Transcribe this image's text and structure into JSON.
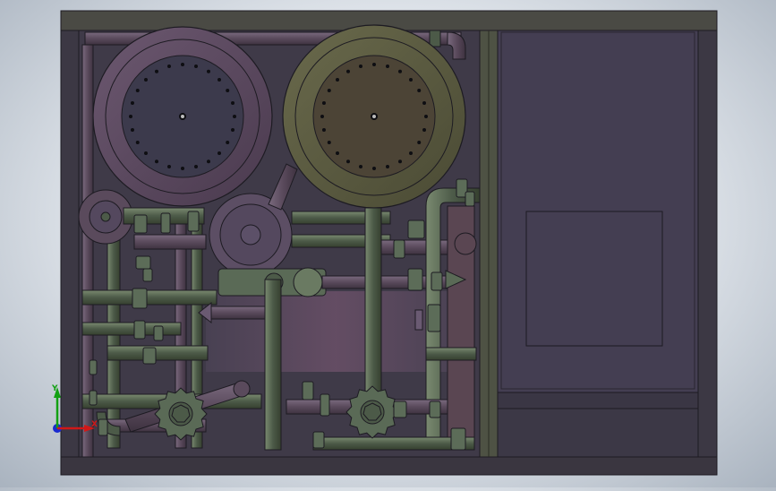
{
  "viewport": {
    "background_top": "#ffffff",
    "background_bottom": "#a9b3bf"
  },
  "colors": {
    "frame": "#3e3a46",
    "frame_edge": "#1d1b22",
    "panel": "#443e52",
    "pipe_green": "#4c5a48",
    "pipe_green_light": "#6a7a62",
    "pipe_purple": "#5a4a5c",
    "tank_left": "#5c4a5e",
    "tank_right": "#5a5a42",
    "pump": "#54485e",
    "valve": "#5a6a56"
  },
  "triad": {
    "y_label": "Y",
    "x_label": "X",
    "y_color": "#12a012",
    "x_color": "#d01818",
    "z_color": "#1a2ad0"
  }
}
